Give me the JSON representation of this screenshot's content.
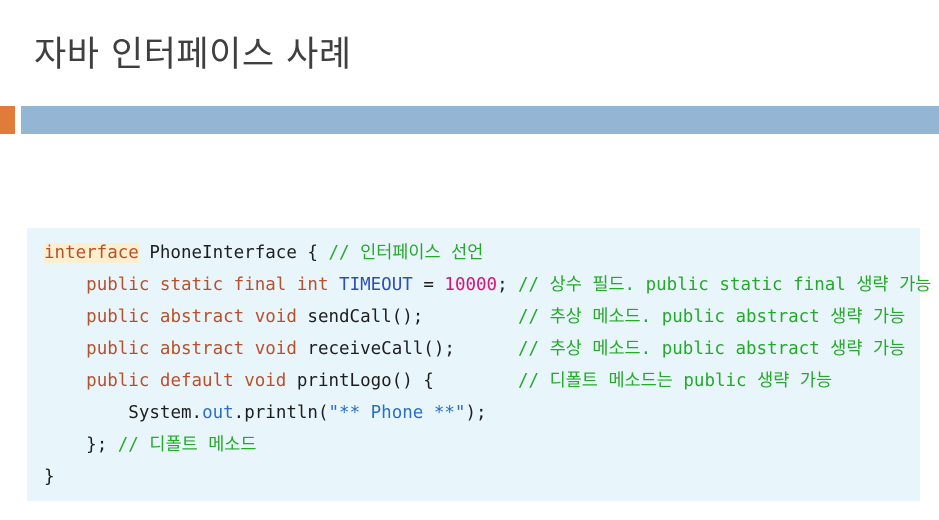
{
  "colors": {
    "accent": "#e07b39",
    "bar": "#94b6d4"
  },
  "title": "자바 인터페이스 사례",
  "code": {
    "l1": {
      "kw": "interface",
      "rest": " PhoneInterface { ",
      "comment": "// 인터페이스 선언"
    },
    "l2": {
      "indent": "    ",
      "kw": "public static final int",
      "sp": " ",
      "const": "TIMEOUT",
      "eq": " = ",
      "num": "10000",
      "semi": ";",
      "comment": "// 상수 필드. public static final 생략 가능"
    },
    "l3": {
      "indent": "    ",
      "kw": "public abstract void",
      "rest": " sendCall();",
      "comment": "// 추상 메소드. public abstract 생략 가능"
    },
    "l4": {
      "indent": "    ",
      "kw": "public abstract void",
      "rest": " receiveCall();",
      "comment": "// 추상 메소드. public abstract 생략 가능"
    },
    "l5": {
      "indent": "    ",
      "kw": "public default void",
      "rest": " printLogo() {",
      "comment": "// 디폴트 메소드는 public 생략 가능"
    },
    "l6": {
      "indent": "        ",
      "pre": "System.",
      "field": "out",
      "mid": ".println(",
      "str": "\"** Phone **\"",
      "post": ");"
    },
    "l7": {
      "indent": "    ",
      "rest": "}; ",
      "comment": "// 디폴트 메소드"
    },
    "l8": {
      "rest": "}"
    }
  }
}
